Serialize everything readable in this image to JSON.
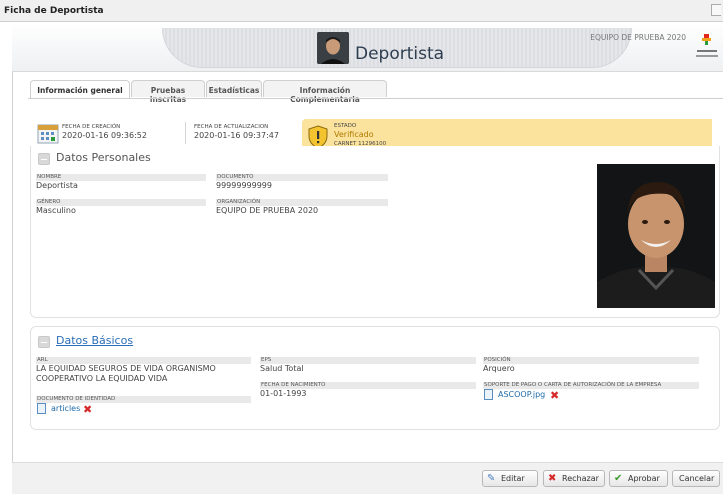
{
  "window": {
    "title": "Ficha de Deportista"
  },
  "header": {
    "page_title": "Deportista",
    "team_name": "EQUIPO DE PRUEBA 2020"
  },
  "tabs": [
    {
      "label": "Información general",
      "active": true
    },
    {
      "label": "Pruebas inscritas",
      "active": false
    },
    {
      "label": "Estadísticas",
      "active": false
    },
    {
      "label": "Información Complementaria",
      "active": false
    }
  ],
  "meta": {
    "created_label": "FECHA DE CREACIÓN",
    "created_value": "2020-01-16 09:36:52",
    "updated_label": "FECHA DE ACTUALIZACION",
    "updated_value": "2020-01-16 09:37:47",
    "status_label": "ESTADO",
    "status_value": "Verificado",
    "carnet": "CARNET 11296100"
  },
  "personal": {
    "title": "Datos Personales",
    "nombre_label": "NOMBRE",
    "nombre_value": "Deportista",
    "documento_label": "DOCUMENTO",
    "documento_value": "99999999999",
    "genero_label": "GÉNERO",
    "genero_value": "Masculino",
    "organizacion_label": "ORGANIZACIÓN",
    "organizacion_value": "EQUIPO DE PRUEBA 2020"
  },
  "basic": {
    "title": "Datos Básicos",
    "arl_label": "ARL",
    "arl_value_1": "LA EQUIDAD SEGUROS DE VIDA ORGANISMO",
    "arl_value_2": "COOPERATIVO LA EQUIDAD VIDA",
    "eps_label": "EPS",
    "eps_value": "Salud Total",
    "posicion_label": "POSICIÓN",
    "posicion_value": "Arquero",
    "nacimiento_label": "FECHA DE NACIMIENTO",
    "nacimiento_value": "01-01-1993",
    "soporte_label": "SOPORTE DE PAGO O CARTA DE AUTORIZACIÓN DE LA EMPRESA",
    "soporte_file": "ASCOOP.jpg",
    "doc_id_label": "DOCUMENTO DE IDENTIDAD",
    "doc_id_file": "articles"
  },
  "buttons": {
    "edit": "Editar",
    "reject": "Rechazar",
    "approve": "Aprobar",
    "cancel": "Cancelar"
  },
  "colors": {
    "status_bg": "#fbe39d",
    "reject": "#d62a2a",
    "approve": "#3d9a2f",
    "link": "#2a6db5"
  }
}
